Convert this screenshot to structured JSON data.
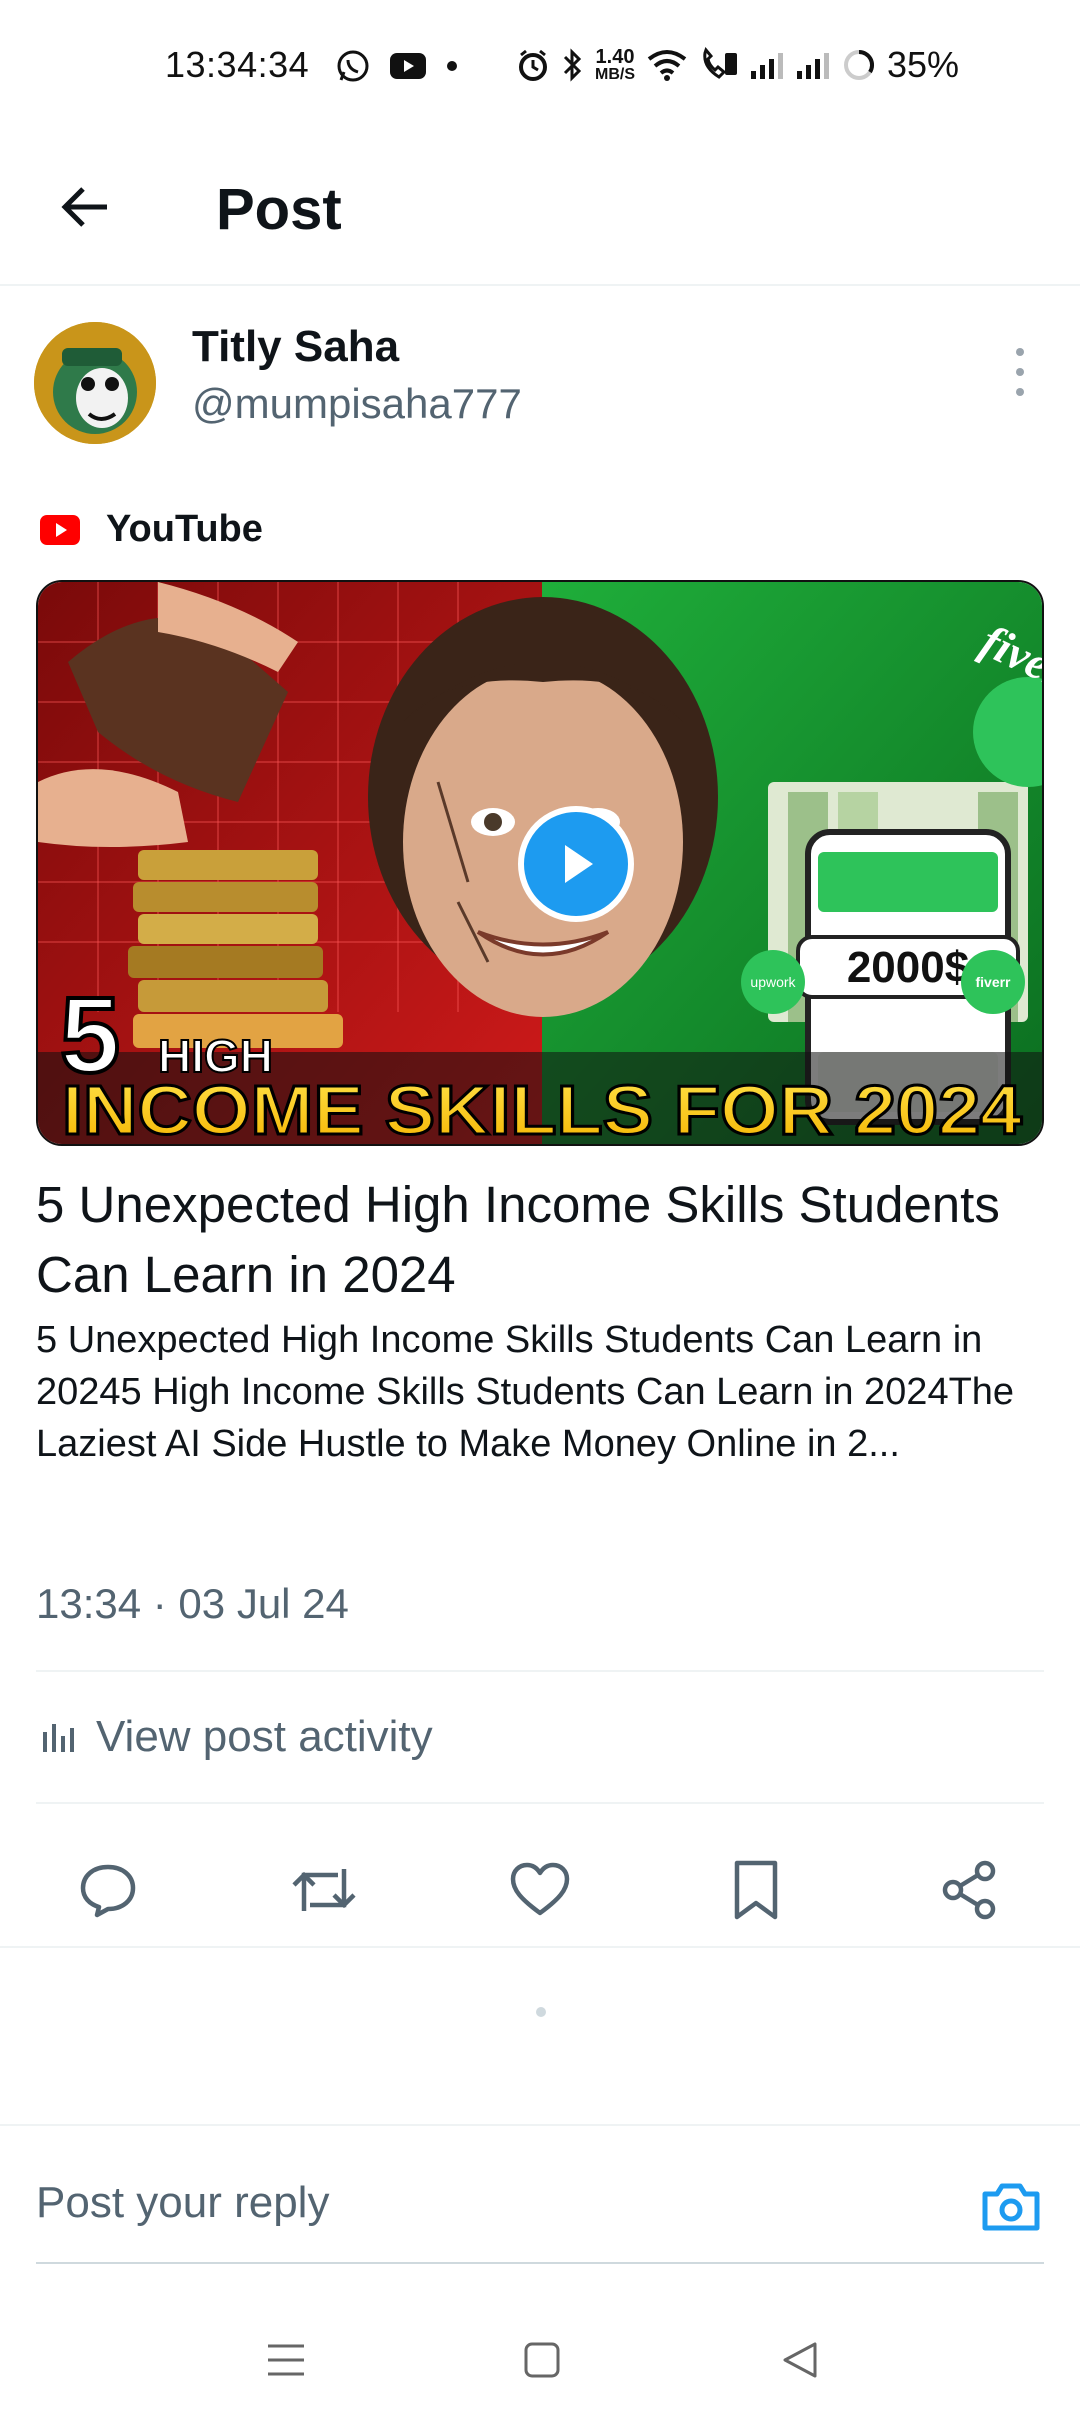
{
  "status_bar": {
    "time": "13:34:34",
    "net_speed_value": "1.40",
    "net_speed_unit": "MB/S",
    "battery": "35%"
  },
  "header": {
    "title": "Post"
  },
  "post": {
    "author_name": "Titly Saha",
    "author_handle": "@mumpisaha777",
    "source_label": "YouTube",
    "thumbnail": {
      "big_number": "5",
      "line_small": "HIGH",
      "line_big": "INCOME SKILLS FOR 2024",
      "money_label": "2000$",
      "brand_text": "fiverr",
      "badge_left": "upwork",
      "badge_right": "fiverr"
    },
    "card_title": "5 Unexpected High Income Skills Students Can Learn in 2024",
    "card_description": "5 Unexpected High Income Skills Students Can Learn in 20245 High Income Skills Students Can Learn in 2024The Laziest AI Side Hustle to Make Money Online in 2...",
    "timestamp": "13:34 · 03 Jul 24",
    "activity_label": "View post activity"
  },
  "reply": {
    "placeholder": "Post your reply"
  },
  "colors": {
    "accent": "#1d9bf0",
    "secondary_text": "#536471",
    "youtube_red": "#ff0000"
  }
}
